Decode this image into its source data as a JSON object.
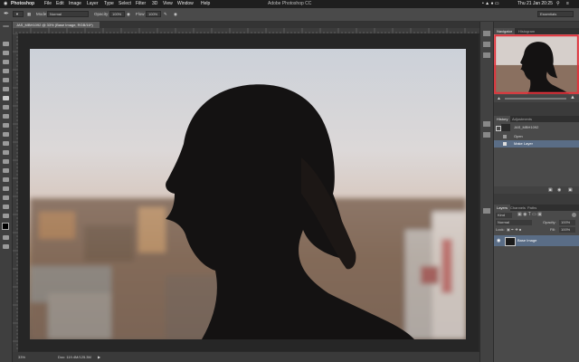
{
  "menubar": {
    "apple": "",
    "app": "Photoshop",
    "menus": [
      "File",
      "Edit",
      "Image",
      "Layer",
      "Type",
      "Select",
      "Filter",
      "3D",
      "View",
      "Window",
      "Help"
    ],
    "window_title": "Adobe Photoshop CC",
    "clock": "Thu 21 Jan  20:25"
  },
  "options": {
    "mode_label": "Mode:",
    "mode_value": "Normal",
    "opacity_label": "Opacity:",
    "opacity_value": "100%",
    "flow_label": "Flow:",
    "flow_value": "100%",
    "workspace": "Essentials"
  },
  "document": {
    "tab_title": "JAS_MBH1092 @ 33% (Base Image, RGB/16*)",
    "zoom": "33%",
    "doc_size": "Doc: 119.4M/125.3M"
  },
  "panels": {
    "navigator_tabs": [
      "Navigator",
      "Histogram"
    ],
    "history_tabs": [
      "History",
      "Adjustments"
    ],
    "history_snapshot": "JAS_MBH1092",
    "history_items": [
      "Open",
      "Make Layer"
    ],
    "layers_tabs": [
      "Layers",
      "Channels",
      "Paths"
    ],
    "layers_kind": "Kind",
    "blend_mode": "Normal",
    "layer_opacity_label": "Opacity:",
    "layer_opacity": "100%",
    "lock_label": "Lock:",
    "fill_label": "Fill:",
    "fill_value": "100%",
    "layer_name": "Base Image"
  },
  "colors": {
    "accent_selection": "#5a6d86",
    "navigator_frame": "#e0333c",
    "ui_dark": "#2b2b2b"
  }
}
